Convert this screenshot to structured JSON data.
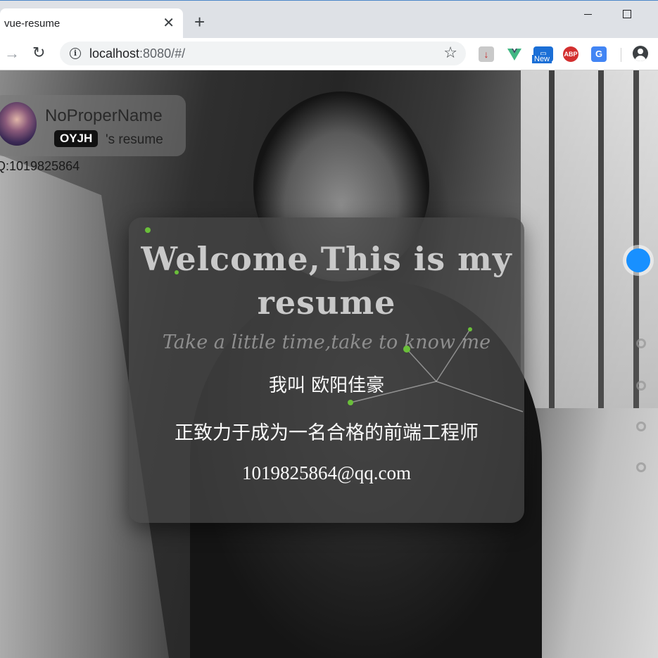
{
  "browser": {
    "tab_title": "vue-resume",
    "tab_close": "✕",
    "new_tab": "+",
    "url_host": "localhost",
    "url_rest": ":8080/#/",
    "ext_abp_label": "ABP",
    "ext_new_badge": "New",
    "ext_translate_label": "G"
  },
  "profile": {
    "name": "NoProperName",
    "nickname": "OYJH",
    "resume_suffix": "'s resume",
    "qq": "Q:1019825864"
  },
  "welcome": {
    "title": "Welcome,This is my resume",
    "subtitle": "Take a little time,take to know me",
    "line1": "我叫 欧阳佳豪",
    "line2": "正致力于成为一名合格的前端工程师",
    "line3": "1019825864@qq.com"
  },
  "colors": {
    "accent": "#1890ff",
    "particle": "#6abf3a"
  },
  "section_nav": {
    "total": 6,
    "active_index": 0
  }
}
